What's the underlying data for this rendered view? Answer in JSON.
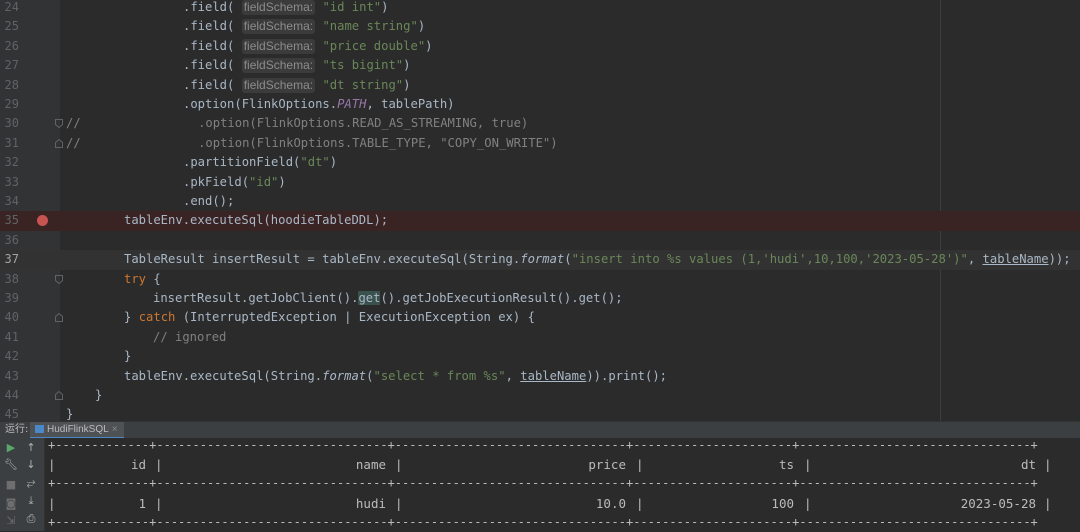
{
  "editor": {
    "lines": [
      {
        "n": "24"
      },
      {
        "n": "25"
      },
      {
        "n": "26"
      },
      {
        "n": "27"
      },
      {
        "n": "28"
      },
      {
        "n": "29"
      },
      {
        "n": "30"
      },
      {
        "n": "31"
      },
      {
        "n": "32"
      },
      {
        "n": "33"
      },
      {
        "n": "34"
      },
      {
        "n": "35"
      },
      {
        "n": "36"
      },
      {
        "n": "37"
      },
      {
        "n": "38"
      },
      {
        "n": "39"
      },
      {
        "n": "40"
      },
      {
        "n": "41"
      },
      {
        "n": "42"
      },
      {
        "n": "43"
      },
      {
        "n": "44"
      },
      {
        "n": "45"
      }
    ],
    "hint_label": "fieldSchema:",
    "t": {
      "field_call": ".field(",
      "close_paren": ")",
      "s_id": "\"id int\"",
      "s_name": "\"name string\"",
      "s_price": "\"price double\"",
      "s_ts": "\"ts bigint\"",
      "s_dt": "\"dt string\"",
      "l29_a": ".option(FlinkOptions.",
      "l29_const": "PATH",
      "l29_b": ", tablePath)",
      "l30": "//                .option(FlinkOptions.READ_AS_STREAMING, true)",
      "l31": "//                .option(FlinkOptions.TABLE_TYPE, \"COPY_ON_WRITE\")",
      "l32_a": ".partitionField(",
      "l32_s": "\"dt\"",
      "l33_a": ".pkField(",
      "l33_s": "\"id\"",
      "l34": ".end();",
      "l35": "tableEnv.executeSql(hoodieTableDDL);",
      "l37_a": "TableResult insertResult = tableEnv.executeSql(String.",
      "l37_fmt": "format",
      "l37_b": "(",
      "l37_s": "\"insert into %s values (1,'hudi',10,100,'2023-05-28')\"",
      "l37_c": ", ",
      "l37_var": "tableName",
      "l37_d": "));",
      "l38_kw": "try",
      "l38_b": " {",
      "l39_a": "insertResult.getJobClient().",
      "l39_get": "get",
      "l39_b": "().getJobExecutionResult().get();",
      "l40_a": "} ",
      "l40_kw": "catch",
      "l40_b": " (InterruptedException | ExecutionException ex) {",
      "l41": "// ignored",
      "l42": "}",
      "l43_a": "tableEnv.executeSql(String.",
      "l43_fmt": "format",
      "l43_b": "(",
      "l43_s": "\"select * from %s\"",
      "l43_c": ", ",
      "l43_var": "tableName",
      "l43_d": ")).print();",
      "l44": "}",
      "l45": "}"
    }
  },
  "run_panel": {
    "title": "运行:",
    "tab_label": "HudiFlinkSQL",
    "tab_close": "×",
    "table": {
      "border": "+-------------+--------------------------------+--------------------------------+----------------------+--------------------------------+",
      "headers": [
        "id",
        "name",
        "price",
        "ts",
        "dt"
      ],
      "rows": [
        [
          "1",
          "hudi",
          "10.0",
          "100",
          "2023-05-28"
        ]
      ],
      "sep": "|"
    }
  },
  "colors": {
    "background": "#2b2b2b",
    "string": "#6a8759",
    "keyword": "#cc7832",
    "comment": "#808080",
    "breakpoint": "#c75450",
    "constant": "#9876aa"
  }
}
